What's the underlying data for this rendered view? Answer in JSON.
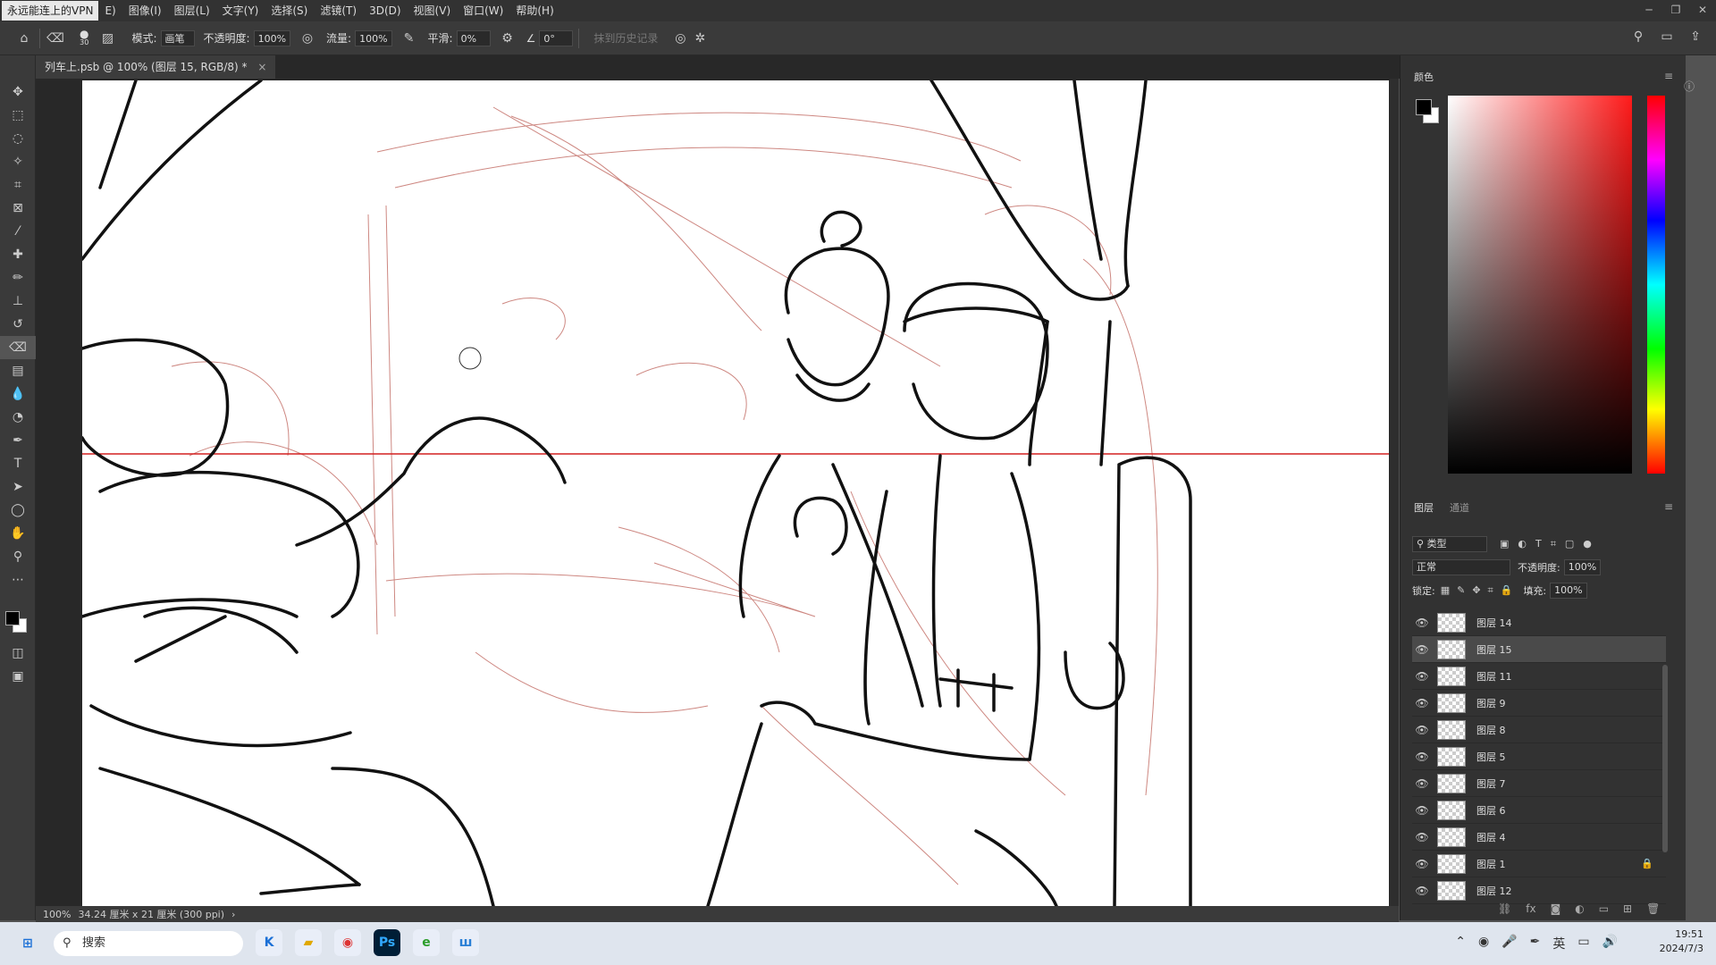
{
  "menubar": {
    "vpn_label": "永远能连上的VPN",
    "items": [
      "E)",
      "图像(I)",
      "图层(L)",
      "文字(Y)",
      "选择(S)",
      "滤镜(T)",
      "3D(D)",
      "视图(V)",
      "窗口(W)",
      "帮助(H)"
    ]
  },
  "options": {
    "brush_size": "30",
    "mode_label": "模式:",
    "mode_value": "画笔",
    "opacity_label": "不透明度:",
    "opacity_value": "100%",
    "flow_label": "流量:",
    "flow_value": "100%",
    "smooth_label": "平滑:",
    "smooth_value": "0%",
    "angle_value": "0°",
    "history_label": "抹到历史记录"
  },
  "document_tab": {
    "title": "列车上.psb @ 100% (图层 15, RGB/8) *"
  },
  "status": {
    "zoom": "100%",
    "doc_size": "34.24 厘米 x 21 厘米 (300 ppi)"
  },
  "color_panel": {
    "title": "颜色",
    "fg_color": "#000000",
    "bg_color": "#ffffff"
  },
  "layers_panel": {
    "tab_layers": "图层",
    "tab_channels": "通道",
    "filter_label": "类型",
    "blend_mode": "正常",
    "opacity_label": "不透明度:",
    "opacity_value": "100%",
    "lock_label": "锁定:",
    "fill_label": "填充:",
    "fill_value": "100%",
    "layers": [
      {
        "name": "图层 14",
        "selected": false,
        "locked": false
      },
      {
        "name": "图层 15",
        "selected": true,
        "locked": false
      },
      {
        "name": "图层 11",
        "selected": false,
        "locked": false
      },
      {
        "name": "图层 9",
        "selected": false,
        "locked": false
      },
      {
        "name": "图层 8",
        "selected": false,
        "locked": false
      },
      {
        "name": "图层 5",
        "selected": false,
        "locked": false
      },
      {
        "name": "图层 7",
        "selected": false,
        "locked": false
      },
      {
        "name": "图层 6",
        "selected": false,
        "locked": false
      },
      {
        "name": "图层 4",
        "selected": false,
        "locked": false
      },
      {
        "name": "图层 1",
        "selected": false,
        "locked": true
      },
      {
        "name": "图层 12",
        "selected": false,
        "locked": false
      }
    ]
  },
  "taskbar": {
    "search_placeholder": "搜索",
    "ime": "英",
    "time": "19:51",
    "date": "2024/7/3"
  }
}
